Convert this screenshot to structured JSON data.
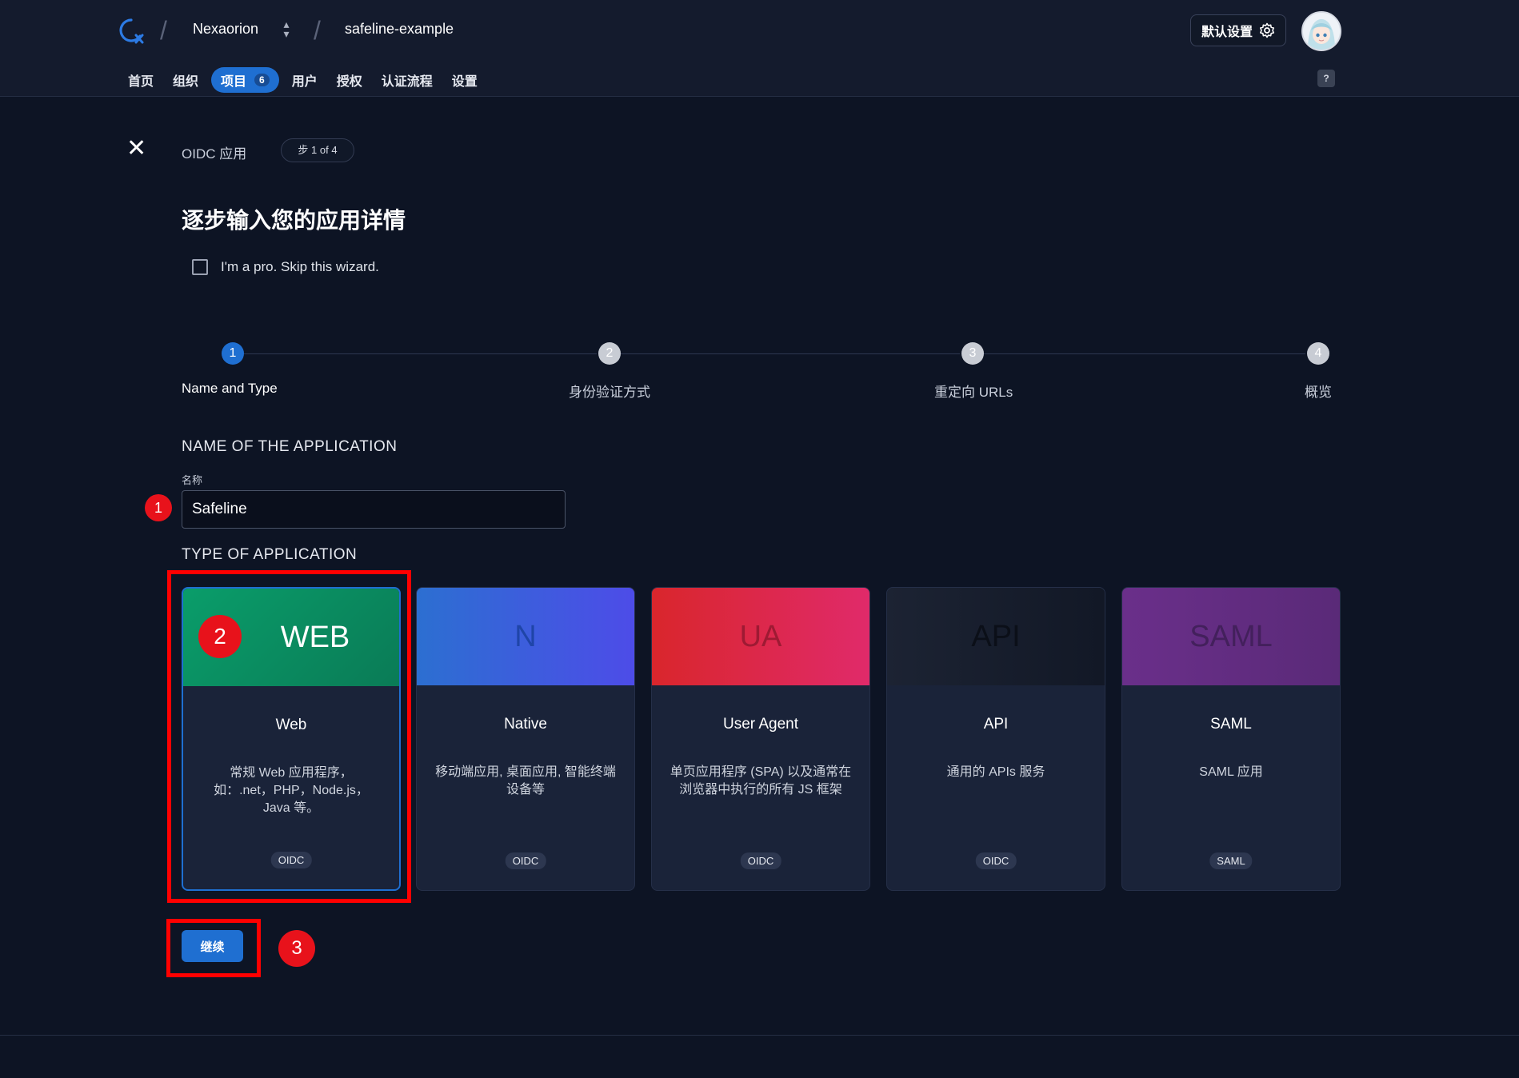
{
  "header": {
    "org_name": "Nexaorion",
    "project_name": "safeline-example",
    "default_settings_label": "默认设置",
    "help_label": "?"
  },
  "nav": {
    "items": [
      {
        "label": "首页"
      },
      {
        "label": "组织"
      },
      {
        "label": "项目",
        "badge": "6",
        "active": true
      },
      {
        "label": "用户"
      },
      {
        "label": "授权"
      },
      {
        "label": "认证流程"
      },
      {
        "label": "设置"
      }
    ]
  },
  "wizard": {
    "close": "✕",
    "title": "OIDC 应用",
    "step_pill": "步 1 of 4",
    "heading": "逐步输入您的应用详情",
    "skip_label": "I'm a pro. Skip this wizard."
  },
  "stepper": {
    "steps": [
      {
        "num": "1",
        "label": "Name and Type",
        "active": true
      },
      {
        "num": "2",
        "label": "身份验证方式"
      },
      {
        "num": "3",
        "label": "重定向 URLs"
      },
      {
        "num": "4",
        "label": "概览"
      }
    ]
  },
  "form": {
    "name_section": "NAME OF THE APPLICATION",
    "name_field_label": "名称",
    "name_value": "Safeline",
    "type_section": "TYPE OF APPLICATION"
  },
  "cards": [
    {
      "banner": "WEB",
      "title": "Web",
      "desc": "常规 Web 应用程序，\n如：.net，PHP，Node.js，\nJava 等。",
      "tag": "OIDC",
      "selected": true
    },
    {
      "banner": "N",
      "title": "Native",
      "desc": "移动端应用, 桌面应用, 智能终端设备等",
      "tag": "OIDC"
    },
    {
      "banner": "UA",
      "title": "User Agent",
      "desc": "单页应用程序 (SPA) 以及通常在浏览器中执行的所有 JS 框架",
      "tag": "OIDC"
    },
    {
      "banner": "API",
      "title": "API",
      "desc": "通用的 APIs 服务",
      "tag": "OIDC"
    },
    {
      "banner": "SAML",
      "title": "SAML",
      "desc": "SAML 应用",
      "tag": "SAML"
    }
  ],
  "continue_label": "继续",
  "markers": [
    "1",
    "2",
    "3"
  ],
  "colors": {
    "accent": "#1f6fd1",
    "annotation_red": "#e8121b"
  }
}
